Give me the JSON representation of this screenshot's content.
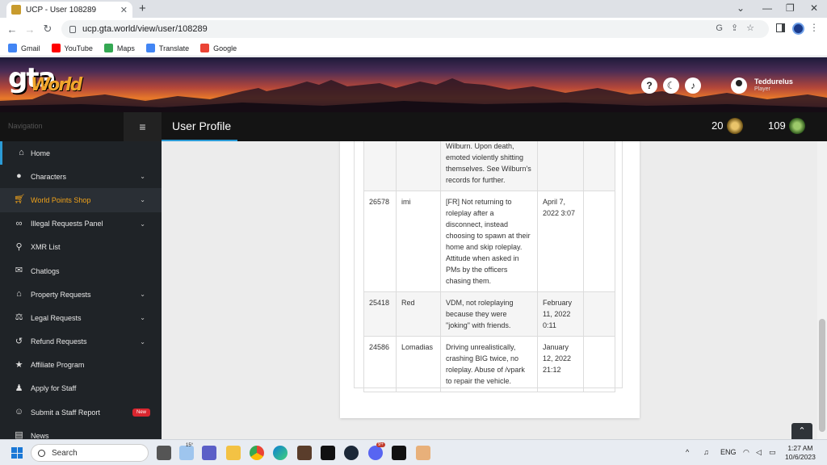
{
  "browser": {
    "tab_title": "UCP - User 108289",
    "url": "ucp.gta.world/view/user/108289",
    "bookmarks": [
      "Gmail",
      "YouTube",
      "Maps",
      "Translate",
      "Google"
    ]
  },
  "header": {
    "logo_main": "gta",
    "logo_sub": "World",
    "help_glyph": "?",
    "username": "Teddurelus",
    "role": "Player"
  },
  "topbar": {
    "nav_label": "Navigation",
    "page_title": "User Profile",
    "stat1": "20",
    "stat2": "109"
  },
  "sidebar": {
    "items": [
      {
        "label": "Home",
        "icon": "home-icon"
      },
      {
        "label": "Characters",
        "icon": "user-icon"
      },
      {
        "label": "World Points Shop",
        "icon": "cart-icon"
      },
      {
        "label": "Illegal Requests Panel",
        "icon": "mask-icon"
      },
      {
        "label": "XMR List",
        "icon": "antenna-icon"
      },
      {
        "label": "Chatlogs",
        "icon": "chat-icon"
      },
      {
        "label": "Property Requests",
        "icon": "house-icon"
      },
      {
        "label": "Legal Requests",
        "icon": "scale-icon"
      },
      {
        "label": "Refund Requests",
        "icon": "undo-icon"
      },
      {
        "label": "Affiliate Program",
        "icon": "star-icon"
      },
      {
        "label": "Apply for Staff",
        "icon": "user-plus-icon"
      },
      {
        "label": "Submit a Staff Report",
        "icon": "face-icon"
      },
      {
        "label": "News",
        "icon": "news-icon"
      }
    ],
    "new_badge": "New"
  },
  "table": {
    "rows": [
      {
        "id": "",
        "admin": "",
        "reason": "Wilburn. Upon death, emoted violently shitting themselves. See Wilburn's records for further.",
        "date": ""
      },
      {
        "id": "26578",
        "admin": "imi",
        "reason": "[FR] Not returning to roleplay after a disconnect, instead choosing to spawn at their home and skip roleplay. Attitude when asked in PMs by the officers chasing them.",
        "date": "April 7, 2022 3:07"
      },
      {
        "id": "25418",
        "admin": "Red",
        "reason": "VDM, not roleplaying because they were \"joking\" with friends.",
        "date": "February 11, 2022 0:11"
      },
      {
        "id": "24586",
        "admin": "Lomadias",
        "reason": "Driving unrealistically, crashing BIG twice, no roleplay. Abuse of /vpark to repair the vehicle.",
        "date": "January 12, 2022 21:12"
      }
    ]
  },
  "scroll_top_glyph": "⌃",
  "taskbar": {
    "search_placeholder": "Search",
    "weather": "15°",
    "lang": "ENG",
    "time": "1:27 AM",
    "date": "10/6/2023",
    "notif_count": "9+"
  }
}
